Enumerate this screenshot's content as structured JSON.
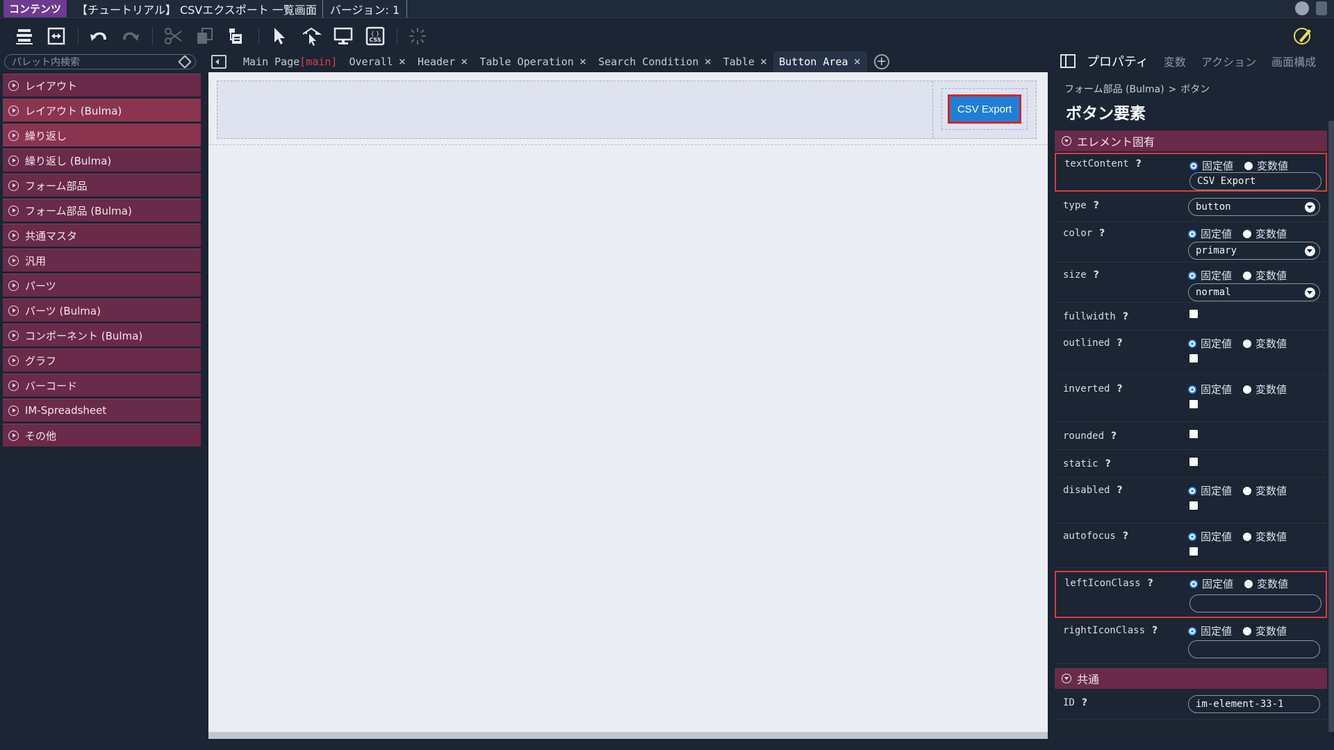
{
  "titlebar": {
    "badge": "コンテンツ",
    "title": "【チュートリアル】 CSVエクスポート 一覧画面",
    "version": "バージョン: 1"
  },
  "toolbar": {
    "icons": [
      "tree-list-icon",
      "expand-icon",
      "undo-icon",
      "redo-icon",
      "cut-icon",
      "copy-icon",
      "paste-icon",
      "select-cursor-icon",
      "parent-select-icon",
      "preview-icon",
      "css-icon",
      "loading-icon",
      "edit-icon"
    ]
  },
  "palette": {
    "search_placeholder": "パレット内検索",
    "items": [
      "レイアウト",
      "レイアウト (Bulma)",
      "繰り返し",
      "繰り返し (Bulma)",
      "フォーム部品",
      "フォーム部品 (Bulma)",
      "共通マスタ",
      "汎用",
      "パーツ",
      "パーツ (Bulma)",
      "コンポーネント (Bulma)",
      "グラフ",
      "バーコード",
      "IM-Spreadsheet",
      "その他"
    ]
  },
  "tabs": {
    "items": [
      {
        "label": "Main Page",
        "tag": "[main]",
        "closable": false
      },
      {
        "label": "Overall",
        "closable": true
      },
      {
        "label": "Header",
        "closable": true
      },
      {
        "label": "Table Operation",
        "closable": true
      },
      {
        "label": "Search Condition",
        "closable": true
      },
      {
        "label": "Table",
        "closable": true
      },
      {
        "label": "Button Area",
        "closable": true,
        "active": true
      }
    ],
    "close_glyph": "×",
    "add_glyph": "+"
  },
  "canvas": {
    "button_label": "CSV Export",
    "button_color": "#1f7fd8"
  },
  "properties": {
    "tabs": [
      "プロパティ",
      "変数",
      "アクション",
      "画面構成"
    ],
    "breadcrumb": [
      "フォーム部品 (Bulma)",
      "ボタン"
    ],
    "breadcrumb_sep": ">",
    "element_title": "ボタン要素",
    "section_specific": "エレメント固有",
    "section_common": "共通",
    "fixed_label": "固定値",
    "variable_label": "変数値",
    "help": "?",
    "rows": {
      "textContent": {
        "name": "textContent",
        "value": "CSV Export"
      },
      "type": {
        "name": "type",
        "value": "button"
      },
      "color": {
        "name": "color",
        "value": "primary"
      },
      "size": {
        "name": "size",
        "value": "normal"
      },
      "fullwidth": {
        "name": "fullwidth"
      },
      "outlined": {
        "name": "outlined"
      },
      "inverted": {
        "name": "inverted"
      },
      "rounded": {
        "name": "rounded"
      },
      "static": {
        "name": "static"
      },
      "disabled": {
        "name": "disabled"
      },
      "autofocus": {
        "name": "autofocus"
      },
      "leftIconClass": {
        "name": "leftIconClass",
        "value": ""
      },
      "rightIconClass": {
        "name": "rightIconClass",
        "value": ""
      },
      "id": {
        "name": "ID",
        "value": "im-element-33-1"
      }
    }
  }
}
